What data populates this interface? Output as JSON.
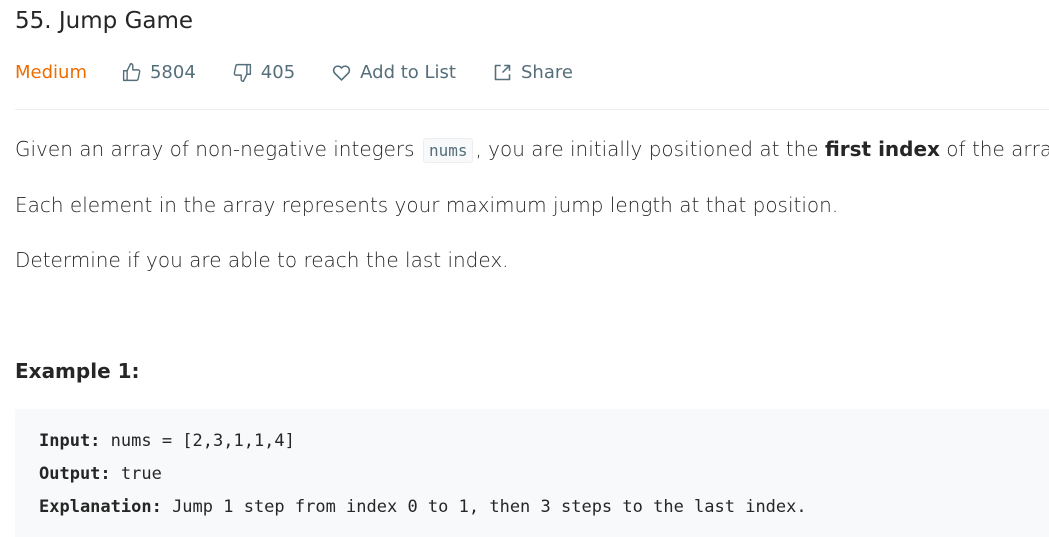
{
  "problem": {
    "title": "55. Jump Game",
    "difficulty": "Medium",
    "likes": "5804",
    "dislikes": "405",
    "add_to_list": "Add to List",
    "share": "Share"
  },
  "description": {
    "p1_before": "Given an array of non-negative integers ",
    "p1_code": "nums",
    "p1_middle": ", you are initially positioned at the ",
    "p1_bold": "first index",
    "p1_after": " of the array.",
    "p2": "Each element in the array represents your maximum jump length at that position.",
    "p3": "Determine if you are able to reach the last index."
  },
  "example1": {
    "title": "Example 1:",
    "input_label": "Input:",
    "input_value": " nums = [2,3,1,1,4]",
    "output_label": "Output:",
    "output_value": " true",
    "explanation_label": "Explanation:",
    "explanation_value": " Jump 1 step from index 0 to 1, then 3 steps to the last index."
  },
  "colors": {
    "difficulty_medium": "#ef6c00",
    "meta_text": "#546e7a",
    "code_bg": "#f7f9fa"
  },
  "icons": {
    "likes": "thumbs-up-icon",
    "dislikes": "thumbs-down-icon",
    "add_to_list": "heart-icon",
    "share": "share-icon"
  }
}
